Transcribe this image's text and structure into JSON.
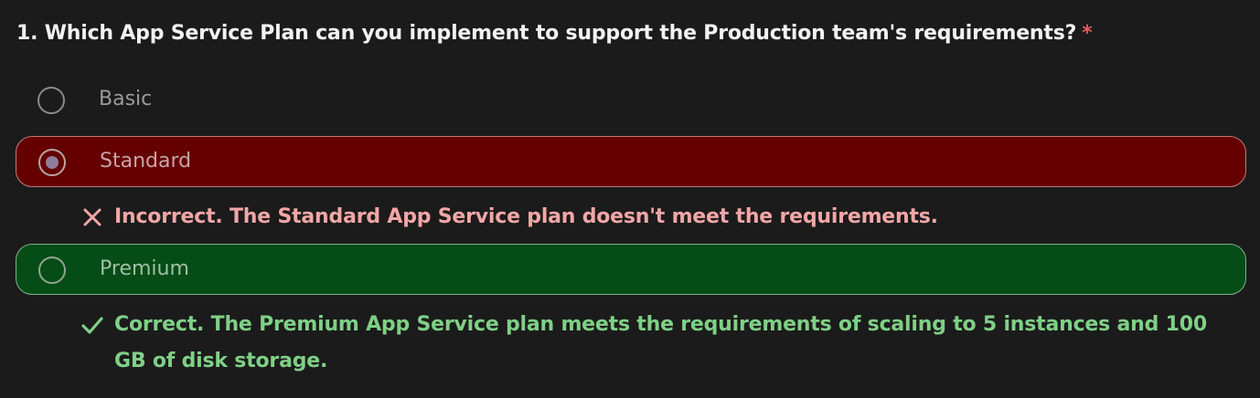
{
  "question": {
    "text": "1. Which App Service Plan can you implement to support the Production team's requirements?",
    "required_marker": "*"
  },
  "options": [
    {
      "label": "Basic",
      "state": "unselected"
    },
    {
      "label": "Standard",
      "state": "selected-incorrect"
    },
    {
      "label": "Premium",
      "state": "correct-answer"
    }
  ],
  "feedback": {
    "incorrect": "Incorrect. The Standard App Service plan doesn't meet the requirements.",
    "correct": "Correct. The Premium App Service plan meets the requirements of scaling to 5 instances and 100 GB of disk storage."
  },
  "icons": {
    "incorrect": "close-icon",
    "correct": "checkmark-icon"
  },
  "colors": {
    "background": "#1b1b1b",
    "incorrect_bg": "#640000",
    "correct_bg": "#064c17",
    "incorrect_text": "#f2a6a6",
    "correct_text": "#7fd086",
    "required": "#e25b5b"
  }
}
